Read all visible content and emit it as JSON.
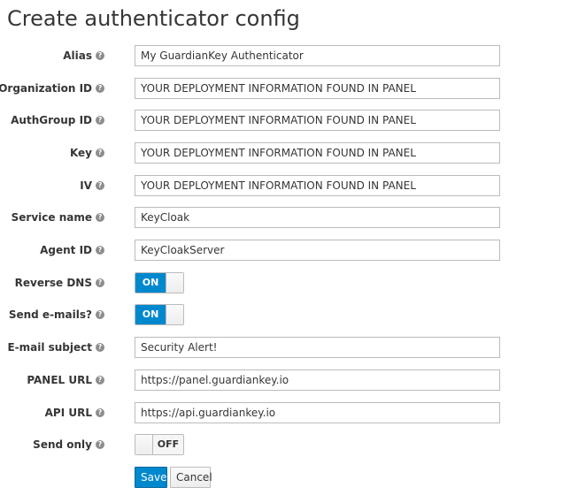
{
  "page": {
    "title": "Create authenticator config"
  },
  "colors": {
    "accent": "#0088ce",
    "help_icon": "#8b8d8f",
    "input_border": "#bbbbbb"
  },
  "help_icon_glyph": "?",
  "fields": {
    "alias": {
      "label": "Alias",
      "value": "My GuardianKey Authenticator"
    },
    "organization_id": {
      "label": "Organization ID",
      "value": "YOUR DEPLOYMENT INFORMATION FOUND IN PANEL"
    },
    "authgroup_id": {
      "label": "AuthGroup ID",
      "value": "YOUR DEPLOYMENT INFORMATION FOUND IN PANEL"
    },
    "key": {
      "label": "Key",
      "value": "YOUR DEPLOYMENT INFORMATION FOUND IN PANEL"
    },
    "iv": {
      "label": "IV",
      "value": "YOUR DEPLOYMENT INFORMATION FOUND IN PANEL"
    },
    "service_name": {
      "label": "Service name",
      "value": "KeyCloak"
    },
    "agent_id": {
      "label": "Agent ID",
      "value": "KeyCloakServer"
    },
    "reverse_dns": {
      "label": "Reverse DNS",
      "state": "ON"
    },
    "send_emails": {
      "label": "Send e-mails?",
      "state": "ON"
    },
    "email_subject": {
      "label": "E-mail subject",
      "value": "Security Alert!"
    },
    "panel_url": {
      "label": "PANEL URL",
      "value": "https://panel.guardiankey.io"
    },
    "api_url": {
      "label": "API URL",
      "value": "https://api.guardiankey.io"
    },
    "send_only": {
      "label": "Send only",
      "state": "OFF"
    }
  },
  "actions": {
    "save_label": "Save",
    "cancel_label": "Cancel"
  }
}
